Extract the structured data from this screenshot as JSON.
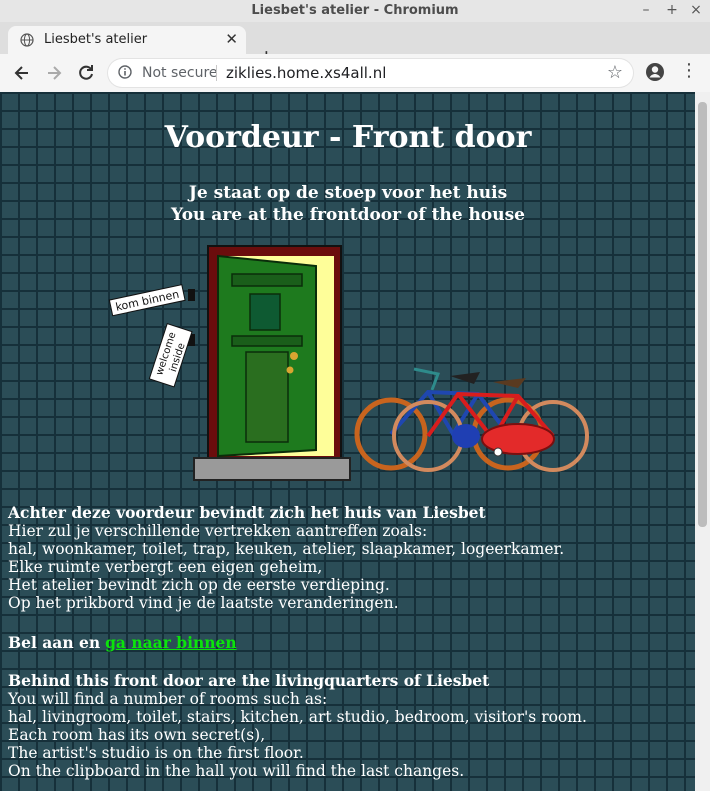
{
  "window": {
    "title": "Liesbet's atelier - Chromium"
  },
  "tab": {
    "title": "Liesbet's atelier"
  },
  "address_bar": {
    "security": "Not secure",
    "url": "ziklies.home.xs4all.nl"
  },
  "page": {
    "heading": "Voordeur - Front door",
    "subtitle_nl": "Je staat op de stoep voor het huis",
    "subtitle_en": "You are at the frontdoor of the house",
    "sign_enter": "kom binnen",
    "sign_welcome": "welcome",
    "sign_inside": "inside",
    "dutch": {
      "heading": "Achter deze voordeur bevindt zich het huis van Liesbet",
      "lines": [
        "Hier zul je verschillende vertrekken aantreffen zoals:",
        "hal, woonkamer, toilet, trap, keuken, atelier, slaapkamer, logeerkamer.",
        "Elke ruimte verbergt een eigen geheim,",
        "Het atelier bevindt zich op de eerste verdieping.",
        "Op het prikbord vind je de laatste veranderingen."
      ]
    },
    "ring": {
      "text": "Bel aan en",
      "link": "ga naar binnen"
    },
    "english": {
      "heading": "Behind this front door are the livingquarters of Liesbet",
      "lines": [
        "You will find a number of rooms such as:",
        "hal, livingroom, toilet, stairs, kitchen, art studio, bedroom, visitor's room.",
        "Each room has its own secret(s),",
        "The artist's studio is on the first floor.",
        "On the clipboard in the hall you will find the last changes."
      ]
    }
  },
  "colors": {
    "background": "#2b4d57",
    "link": "#0be40b",
    "text": "#ffffff"
  }
}
